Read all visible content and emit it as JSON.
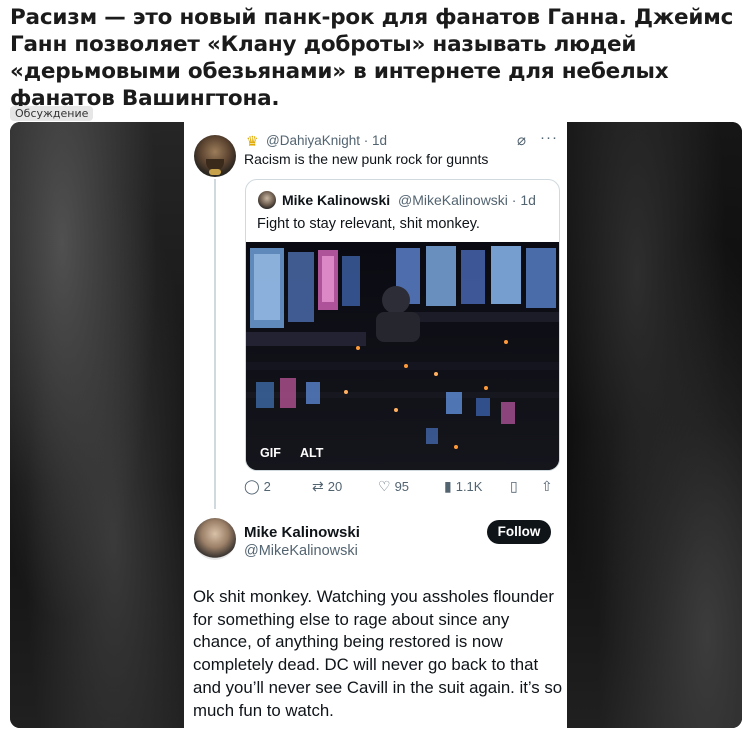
{
  "article": {
    "headline": "Расизм — это новый панк-рок для фанатов Ганна. Джеймс Ганн позволяет «Клану доброты» называть людей «дерьмовыми обезьянами» в интернете для небелых фанатов Вашингтона.",
    "badge": "Обсуждение"
  },
  "tweet1": {
    "handle_time": "@DahiyaKnight · 1d",
    "text": "Racism is the new punk rock for gunnts",
    "icons": [
      "crown-icon",
      "grok-icon",
      "more-icon"
    ],
    "quote": {
      "name": "Mike Kalinowski",
      "handle_time": "@MikeKalinowski · 1d",
      "text": "Fight to stay relevant, shit monkey.",
      "gif_label": "GIF",
      "alt_label": "ALT"
    },
    "actions": {
      "replies": "2",
      "retweets": "20",
      "likes": "95",
      "views": "1.1K"
    }
  },
  "tweet2": {
    "name": "Mike Kalinowski",
    "handle": "@MikeKalinowski",
    "follow_label": "Follow",
    "text": "Ok shit monkey. Watching you assholes flounder for something else to rage about since any chance, of anything being restored is now completely dead. DC will never go back to that and you’ll never see Cavill in the suit again. it’s so much fun to watch."
  },
  "colors": {
    "text_primary": "#0f1419",
    "text_secondary": "#536471",
    "border": "#cfd9de",
    "follow_bg": "#0f1419"
  }
}
